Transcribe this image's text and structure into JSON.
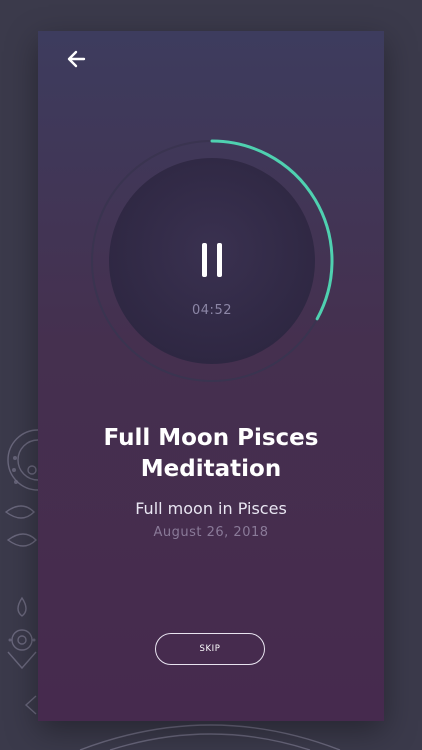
{
  "header": {
    "back_icon": "arrow-left-icon"
  },
  "player": {
    "state": "playing",
    "control_icon": "pause-icon",
    "time_remaining": "04:52",
    "progress": 0.33,
    "progress_color": "#4fd1b0"
  },
  "meditation": {
    "title": "Full Moon Pisces Meditation",
    "subtitle": "Full moon in Pisces",
    "date": "August 26, 2018"
  },
  "actions": {
    "skip_label": "SKIP"
  }
}
